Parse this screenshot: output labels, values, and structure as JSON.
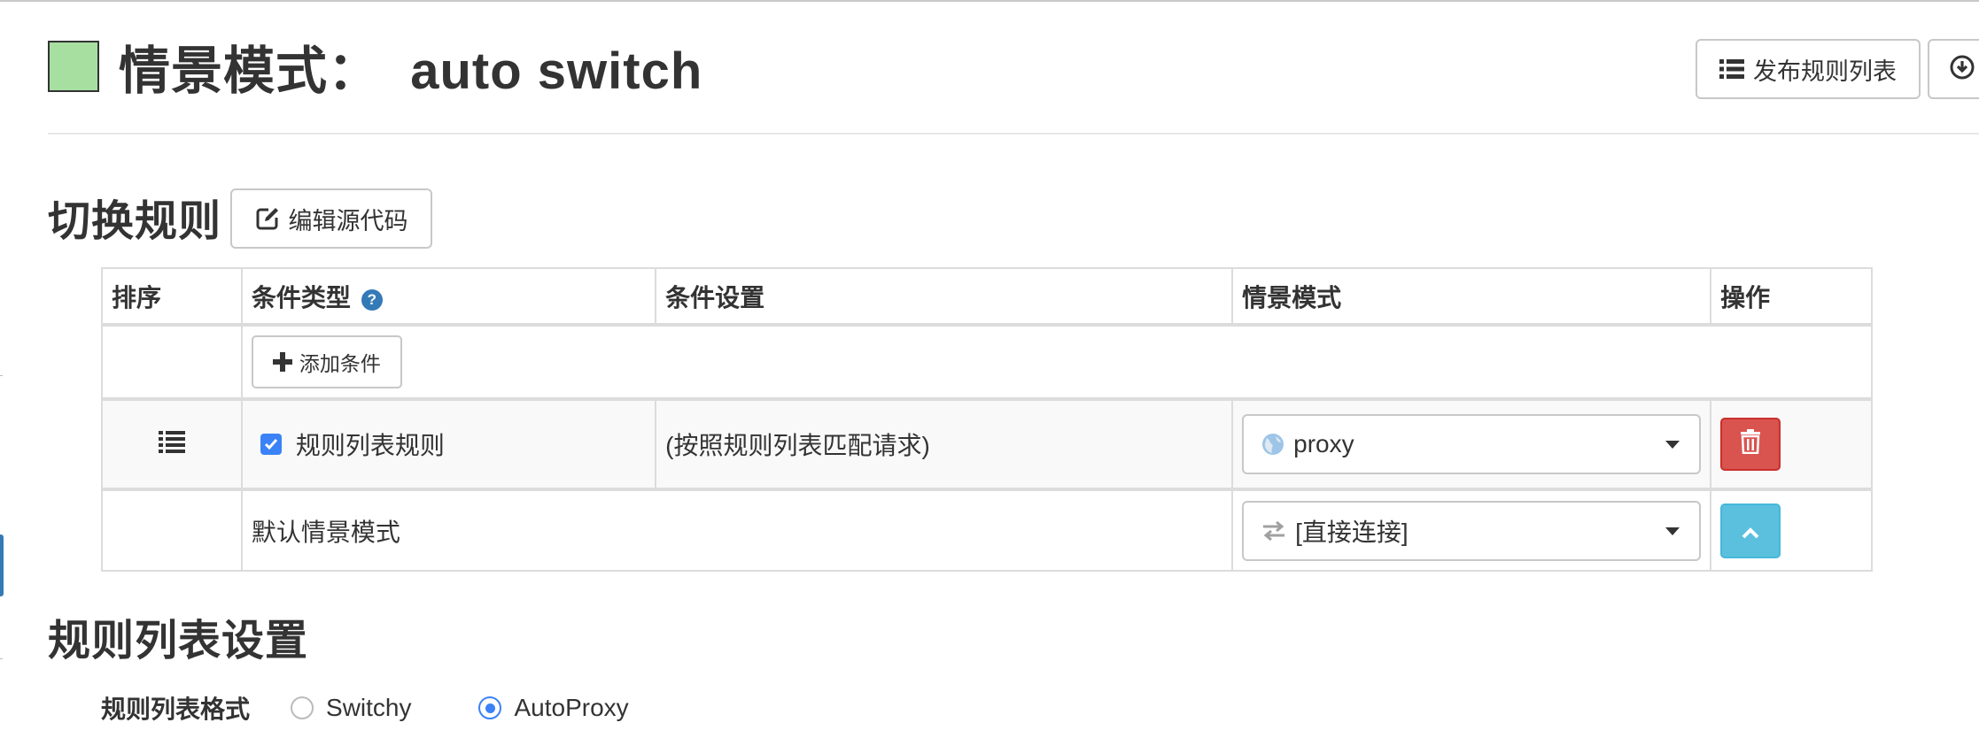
{
  "header": {
    "title": "情景模式：  auto switch",
    "swatch_color": "#a7dfa1",
    "publish_button": "发布规则列表",
    "publish_icon": "list-icon",
    "download_icon": "download-circle-icon"
  },
  "rules_section": {
    "title": "切换规则",
    "edit_source_button": "编辑源代码",
    "edit_icon": "edit-square-icon",
    "columns": [
      "排序",
      "条件类型",
      "条件设置",
      "情景模式",
      "操作"
    ],
    "add_condition_button": "添加条件",
    "rules": [
      {
        "drag_icon": "list-icon",
        "checked": true,
        "condition_type": "规则列表规则",
        "condition_setting": "(按照规则列表匹配请求)",
        "profile": "proxy",
        "profile_icon": "globe-icon",
        "action_icon": "trash-icon"
      }
    ],
    "default_row": {
      "label": "默认情景模式",
      "profile": "[直接连接]",
      "profile_icon": "transfer-arrows-icon",
      "action_icon": "chevron-up-icon"
    }
  },
  "rule_list_section": {
    "title": "规则列表设置",
    "format_label": "规则列表格式",
    "format_options": [
      "Switchy",
      "AutoProxy"
    ],
    "selected_format": "AutoProxy"
  },
  "colors": {
    "danger": "#d9534f",
    "info": "#5bc0de",
    "primary": "#337ab7",
    "checkbox": "#3b82f6"
  }
}
